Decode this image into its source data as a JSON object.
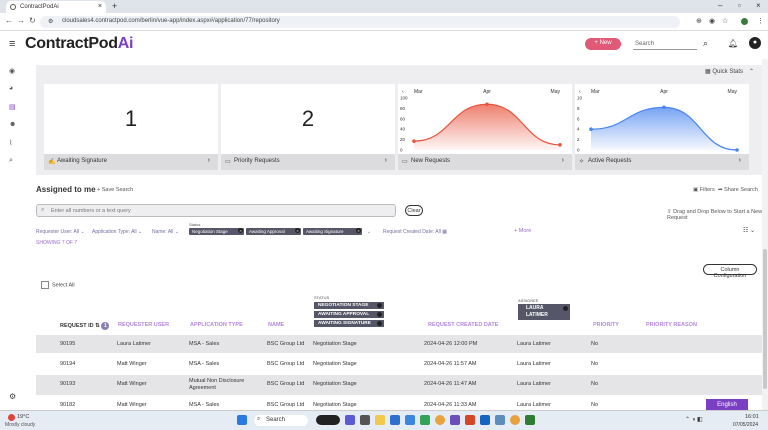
{
  "browser": {
    "tab_title": "ContractPodAi",
    "url": "cloudsales4.contractpod.com/berlin/vue-app/index.aspx#/application/77/repository"
  },
  "header": {
    "logo_main": "ContractPod",
    "logo_ai": "Ai",
    "new_label": "+ New",
    "search_placeholder": "Search"
  },
  "quick_stats": {
    "label": "Quick Stats",
    "cards": [
      {
        "value": "1",
        "label": "Awaiting Signature",
        "icon": "signature-icon"
      },
      {
        "value": "2",
        "label": "Priority Requests",
        "icon": "document-icon"
      },
      {
        "label": "New Requests",
        "icon": "document-icon"
      },
      {
        "label": "Active Requests",
        "icon": "star-icon"
      }
    ]
  },
  "chart_data": [
    {
      "type": "area",
      "categories": [
        "Mar",
        "Apr",
        "May"
      ],
      "values": [
        17,
        88,
        10
      ],
      "ylim": [
        0,
        100
      ],
      "yticks": [
        0,
        20,
        40,
        60,
        80,
        100
      ],
      "color": "#e8553e"
    },
    {
      "type": "area",
      "categories": [
        "Mar",
        "Apr",
        "May"
      ],
      "values": [
        4,
        8.2,
        0
      ],
      "ylim": [
        0,
        10
      ],
      "yticks": [
        0,
        2,
        4,
        6,
        8,
        10
      ],
      "color": "#4a86f0"
    }
  ],
  "assigned": {
    "title": "Assigned to me",
    "save_search": "Save Search",
    "filters": "Filters",
    "share_search": "Share Search",
    "search_placeholder": "Enter all numbers or a text query",
    "clear": "Clear",
    "drag_drop": "Drag and Drop Below to Start a New Request",
    "filter_requester": "Requester User: All",
    "filter_app_type": "Application Type: All",
    "filter_name": "Name: All",
    "status_label": "Status",
    "status_chips": [
      "Negotiation Stage",
      "Awaiting Approval",
      "Awaiting Signature"
    ],
    "filter_created": "Request Created Date: All",
    "more": "+ More",
    "showing": "SHOWING 7 OF 7",
    "column_config": "Column Configuration",
    "select_all": "Select All"
  },
  "table": {
    "status_label": "STATUS",
    "status_chips": [
      "NEGOTIATION STAGE",
      "AWAITING APPROVAL",
      "AWAITING SIGNATURE"
    ],
    "assignee_label": "ASSIGNEE",
    "assignee_chip_1": "LAURA",
    "assignee_chip_2": "LATIMER",
    "headers": [
      "REQUEST ID",
      "REQUESTER USER",
      "APPLICATION TYPE",
      "NAME",
      "",
      "REQUEST CREATED DATE",
      "",
      "PRIORITY",
      "PRIORITY REASON"
    ],
    "sort_badge": "1",
    "rows": [
      [
        "90195",
        "Laura Latimer",
        "MSA - Sales",
        "BSC Group Ltd",
        "Negotiation Stage",
        "2024-04-26 12:00 PM",
        "Laura Latimer",
        "No"
      ],
      [
        "90194",
        "Matt Winger",
        "MSA - Sales",
        "BSC Group Ltd",
        "Negotiation Stage",
        "2024-04-26 11:57 AM",
        "Laura Latimer",
        "No"
      ],
      [
        "90193",
        "Matt Winger",
        "Mutual Non Disclosure Agreement",
        "BSC Group Ltd",
        "Negotiation Stage",
        "2024-04-26 11:47 AM",
        "Laura Latimer",
        "No"
      ],
      [
        "90182",
        "Matt Winger",
        "MSA - Sales",
        "BSC Group Ltd",
        "Negotiation Stage",
        "2024-04-26 11:33 AM",
        "Laura Latimer",
        "No"
      ]
    ]
  },
  "language_button": "English",
  "taskbar": {
    "weather_temp": "19°C",
    "weather_desc": "Mostly cloudy",
    "search_label": "Search",
    "time": "16:01",
    "date": "07/05/2024"
  }
}
